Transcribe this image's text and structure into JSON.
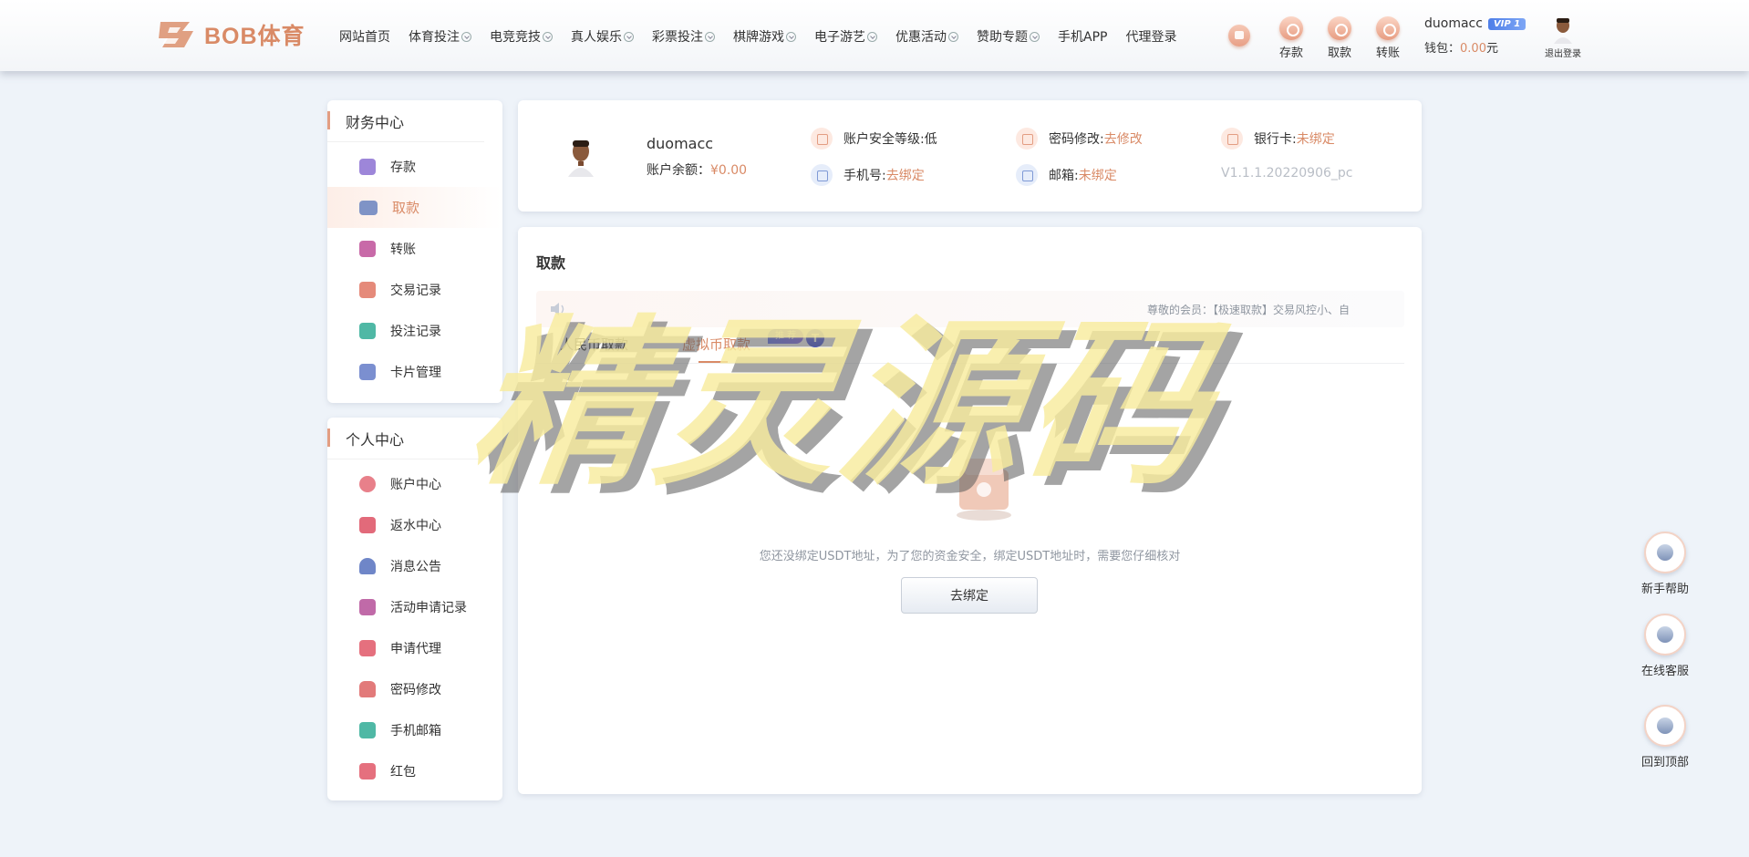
{
  "header": {
    "logo_text": "BOB体育",
    "nav": [
      {
        "label": "网站首页",
        "dropdown": false
      },
      {
        "label": "体育投注",
        "dropdown": true
      },
      {
        "label": "电竞竞技",
        "dropdown": true
      },
      {
        "label": "真人娱乐",
        "dropdown": true
      },
      {
        "label": "彩票投注",
        "dropdown": true
      },
      {
        "label": "棋牌游戏",
        "dropdown": true
      },
      {
        "label": "电子游艺",
        "dropdown": true
      },
      {
        "label": "优惠活动",
        "dropdown": true
      },
      {
        "label": "赞助专题",
        "dropdown": true
      },
      {
        "label": "手机APP",
        "dropdown": false
      },
      {
        "label": "代理登录",
        "dropdown": false
      }
    ],
    "quick_actions": {
      "deposit": "存款",
      "withdraw": "取款",
      "transfer": "转账"
    },
    "username": "duomacc",
    "vip": "VIP 1",
    "wallet_label": "钱包：",
    "wallet_value": "0.00",
    "wallet_unit": "元",
    "logout": "退出登录"
  },
  "sidebar": {
    "finance_title": "财务中心",
    "finance_items": [
      {
        "label": "存款",
        "icon": "deposit-icon",
        "color": "#9d86d9"
      },
      {
        "label": "取款",
        "icon": "wallet-icon",
        "color": "#7f93c6",
        "active": true
      },
      {
        "label": "转账",
        "icon": "transfer-icon",
        "color": "#c86aa8"
      },
      {
        "label": "交易记录",
        "icon": "record-icon",
        "color": "#e58a7a"
      },
      {
        "label": "投注记录",
        "icon": "bet-record-icon",
        "color": "#4fb8a5"
      },
      {
        "label": "卡片管理",
        "icon": "card-icon",
        "color": "#7b8fd0"
      }
    ],
    "personal_title": "个人中心",
    "personal_items": [
      {
        "label": "账户中心",
        "icon": "heart-icon",
        "color": "#e8808a"
      },
      {
        "label": "返水中心",
        "icon": "gift-icon",
        "color": "#e26a7a"
      },
      {
        "label": "消息公告",
        "icon": "bell-icon",
        "color": "#6f86c8"
      },
      {
        "label": "活动申请记录",
        "icon": "user-card-icon",
        "color": "#c06aa8"
      },
      {
        "label": "申请代理",
        "icon": "agent-icon",
        "color": "#e5707e"
      },
      {
        "label": "密码修改",
        "icon": "lock-icon",
        "color": "#e27a7a"
      },
      {
        "label": "手机邮箱",
        "icon": "mail-icon",
        "color": "#4fb8a5"
      },
      {
        "label": "红包",
        "icon": "red-packet-icon",
        "color": "#e5707e"
      }
    ]
  },
  "profile": {
    "username": "duomacc",
    "balance_label": "账户余额：",
    "balance_value": "¥0.00",
    "security_label": "账户安全等级: ",
    "security_value": "低",
    "password_label": "密码修改: ",
    "password_value": "去修改",
    "bank_label": "银行卡: ",
    "bank_value": "未绑定",
    "phone_label": "手机号: ",
    "phone_value": "去绑定",
    "email_label": "邮箱: ",
    "email_value": "未绑定",
    "version": "V1.1.1.20220906_pc"
  },
  "main": {
    "title": "取款",
    "notice": "尊敬的会员：【极速取款】交易风控小、自",
    "tabs": [
      {
        "label": "人民币取款"
      },
      {
        "label": "虚拟币取款",
        "active": true,
        "tag": "推 荐",
        "coin": "T"
      }
    ],
    "empty_text": "您还没绑定USDT地址，为了您的资金安全，绑定USDT地址时，需要您仔细核对",
    "bind_button": "去绑定"
  },
  "float": {
    "help": "新手帮助",
    "service": "在线客服",
    "top": "回到顶部"
  },
  "watermark": "精灵源码",
  "colors": {
    "accent": "#d98a66",
    "vip": "#4d7ee8",
    "muted": "#8f96a0"
  }
}
